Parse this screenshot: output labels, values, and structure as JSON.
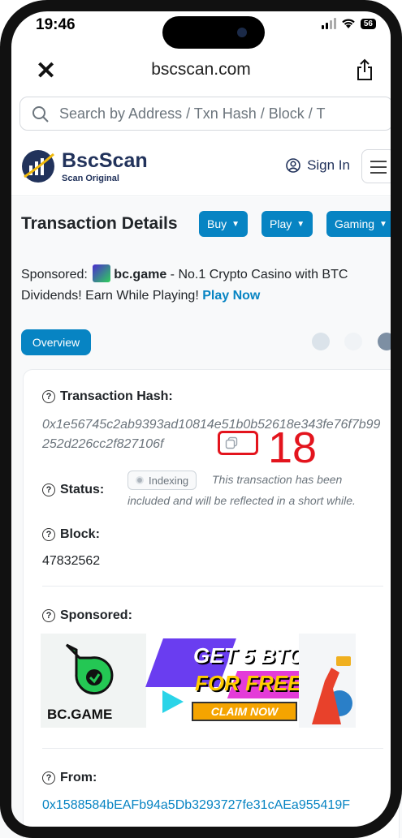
{
  "status_bar": {
    "time": "19:46",
    "battery": "56"
  },
  "browser": {
    "close_label": "✕",
    "url": "bscscan.com",
    "share_icon": "share-icon"
  },
  "search": {
    "placeholder": "Search by Address / Txn Hash / Block / T"
  },
  "header": {
    "logo_name": "BscScan",
    "logo_tagline": "Scan Original",
    "signin_label": "Sign In"
  },
  "title_row": {
    "title": "Transaction Details",
    "buttons": [
      {
        "label": "Buy"
      },
      {
        "label": "Play"
      },
      {
        "label": "Gaming"
      }
    ]
  },
  "sponsor": {
    "prefix": "Sponsored:",
    "brand": "bc.game",
    "text": "- No.1 Crypto Casino with BTC Dividends! Earn While Playing!",
    "cta": "Play Now"
  },
  "tabs": {
    "overview": "Overview"
  },
  "details": {
    "hash_label": "Transaction Hash:",
    "hash_value": "0x1e56745c2ab9393ad10814e51b0b52618e343fe76f7b99252d226cc2f827106f",
    "status_label": "Status:",
    "status_badge": "Indexing",
    "status_note_1": "This transaction has been",
    "status_note_2": "included and will be reflected in a short while.",
    "block_label": "Block:",
    "block_value": "47832562",
    "sponsored_label": "Sponsored:",
    "from_label": "From:",
    "from_value": "0x1588584bEAFb94a5Db3293727fe31cAEa955419F"
  },
  "ad_banner": {
    "brand": "BC.GAME",
    "line1": "GET 5 BTC",
    "line2": "FOR FREE",
    "cta": "CLAIM NOW"
  },
  "annotation": {
    "number": "18"
  },
  "colors": {
    "primary": "#0784c3",
    "brand_navy": "#21325b",
    "highlight": "#e3141d"
  }
}
